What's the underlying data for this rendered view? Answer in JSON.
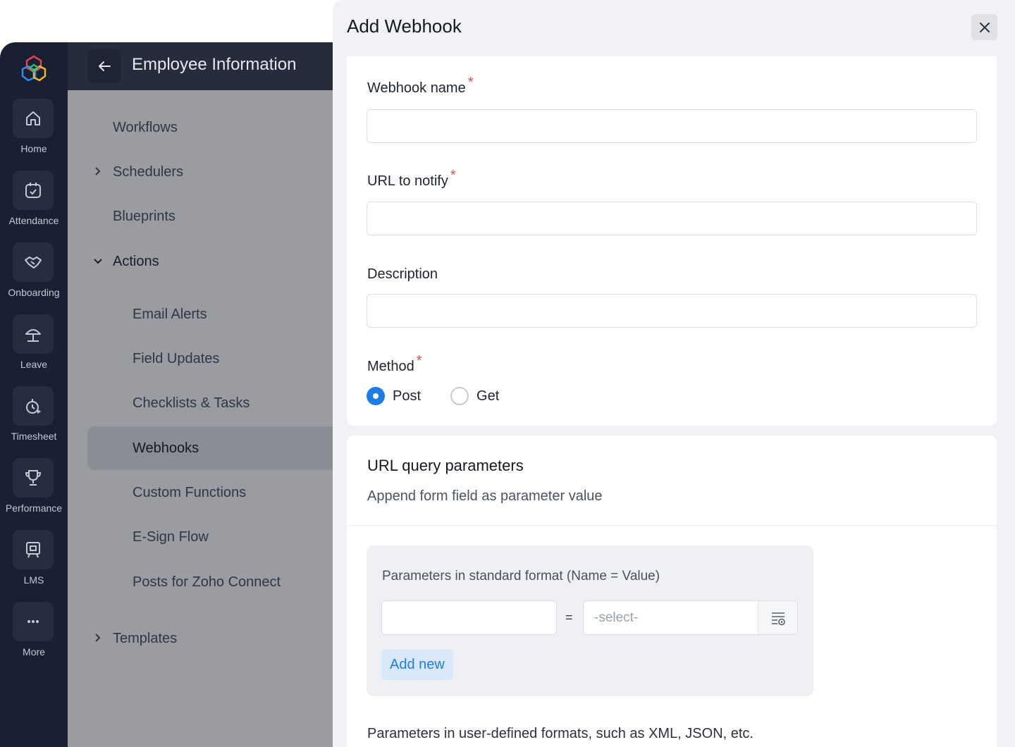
{
  "rail": {
    "items": [
      {
        "label": "Home",
        "icon": "home-icon"
      },
      {
        "label": "Attendance",
        "icon": "calendar-check-icon"
      },
      {
        "label": "Onboarding",
        "icon": "handshake-icon"
      },
      {
        "label": "Leave",
        "icon": "umbrella-icon"
      },
      {
        "label": "Timesheet",
        "icon": "stopwatch-icon"
      },
      {
        "label": "Performance",
        "icon": "trophy-icon"
      },
      {
        "label": "LMS",
        "icon": "board-icon"
      },
      {
        "label": "More",
        "icon": "more-dots-icon"
      }
    ]
  },
  "main": {
    "title": "Employee Information",
    "nav": [
      {
        "label": "Workflows"
      },
      {
        "label": "Schedulers"
      },
      {
        "label": "Blueprints"
      },
      {
        "label": "Actions"
      },
      {
        "label": "Email Alerts"
      },
      {
        "label": "Field Updates"
      },
      {
        "label": "Checklists & Tasks"
      },
      {
        "label": "Webhooks"
      },
      {
        "label": "Custom Functions"
      },
      {
        "label": "E-Sign Flow"
      },
      {
        "label": "Posts for Zoho Connect"
      },
      {
        "label": "Templates"
      }
    ]
  },
  "dialog": {
    "title": "Add Webhook",
    "required_mark": "*",
    "fields": {
      "webhook_name": {
        "label": "Webhook name",
        "value": ""
      },
      "url": {
        "label": "URL to notify",
        "value": ""
      },
      "description": {
        "label": "Description",
        "value": ""
      }
    },
    "method": {
      "label": "Method",
      "options": [
        "Post",
        "Get"
      ],
      "selected": "Post"
    },
    "query": {
      "title": "URL query parameters",
      "subtitle": "Append form field as parameter value",
      "standard_title": "Parameters in standard format (Name = Value)",
      "equals": "=",
      "select_placeholder": "-select-",
      "add_new": "Add new",
      "user_defined_note": "Parameters in user-defined formats, such as XML, JSON, etc."
    }
  },
  "colors": {
    "accent": "#1d7de8",
    "required": "#e5484d",
    "rail_bg": "#1a2033"
  }
}
